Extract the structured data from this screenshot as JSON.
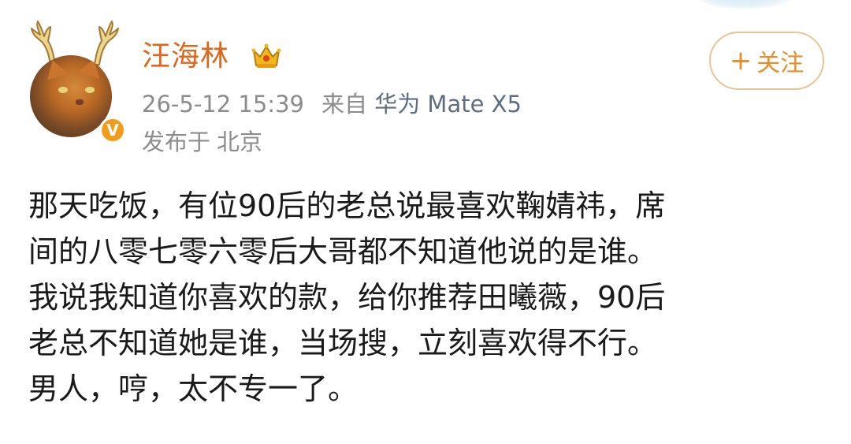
{
  "user": {
    "name": "汪海林",
    "timestamp": "26-5-12 15:39",
    "source_prefix": "来自",
    "device": "华为 Mate X5",
    "location_prefix": "发布于",
    "location": "北京",
    "verified_badge": "V"
  },
  "follow_button": {
    "plus": "+",
    "label": "关注"
  },
  "post": {
    "lines": [
      "那天吃饭，有位90后的老总说最喜欢鞠婧祎，席",
      "间的八零七零六零后大哥都不知道他说的是谁。",
      "我说我知道你喜欢的款，给你推荐田曦薇，90后",
      "老总不知道她是谁，当场搜，立刻喜欢得不行。",
      "男人，哼，太不专一了。"
    ]
  },
  "icons": {
    "avatar": "orange-cat-avatar",
    "antlers": "antler-decoration",
    "crown": "crown-icon",
    "verified": "verified-badge-icon"
  },
  "colors": {
    "username": "#e2661a",
    "meta": "#8c8c8c",
    "device": "#5e6e80",
    "follow_text": "#e58e2a",
    "follow_border": "#e8c595",
    "body_text": "#1a1a1a",
    "verified_badge": "#f39c1a"
  }
}
